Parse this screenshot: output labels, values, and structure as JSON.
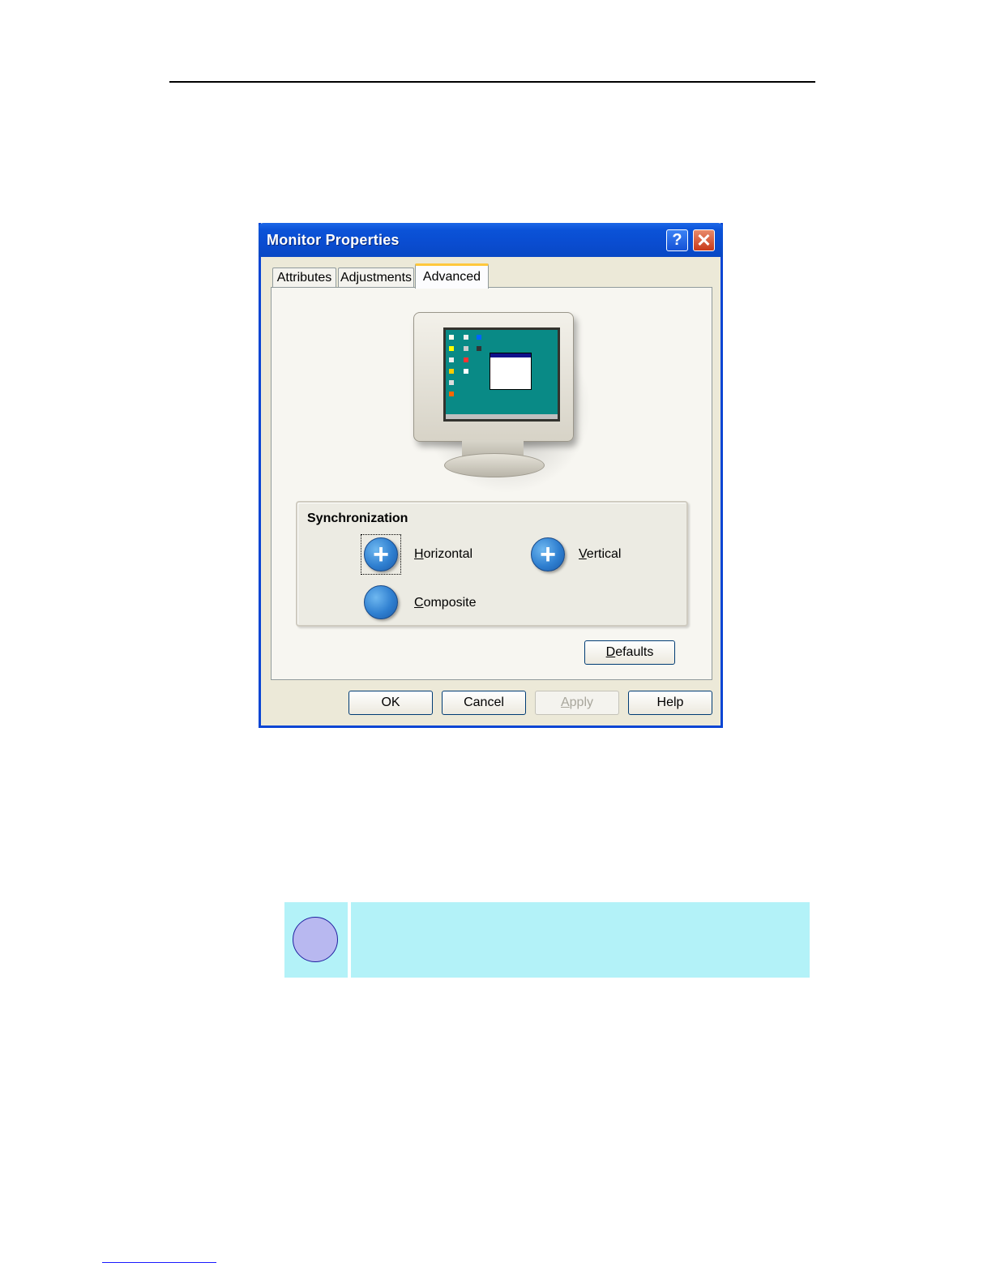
{
  "window": {
    "title": "Monitor Properties",
    "help_glyph": "?",
    "close_glyph": "✕"
  },
  "tabs": [
    {
      "label": "Attributes",
      "active": false
    },
    {
      "label": "Adjustments",
      "active": false
    },
    {
      "label": "Advanced",
      "active": true
    }
  ],
  "sync": {
    "title": "Synchronization",
    "horizontal": {
      "mnemonic": "H",
      "rest": "orizontal",
      "glyph": "+"
    },
    "vertical": {
      "mnemonic": "V",
      "rest": "ertical",
      "glyph": "+"
    },
    "composite": {
      "mnemonic": "C",
      "rest": "omposite"
    }
  },
  "buttons": {
    "defaults": {
      "mnemonic": "D",
      "rest": "efaults"
    },
    "ok": "OK",
    "cancel": "Cancel",
    "apply": {
      "mnemonic": "A",
      "rest": "pply"
    },
    "help": "Help"
  },
  "colors": {
    "titlebar": "#0a4cd0",
    "note_bg": "#b3f2f8",
    "sync_button": "#2f7fd0"
  }
}
